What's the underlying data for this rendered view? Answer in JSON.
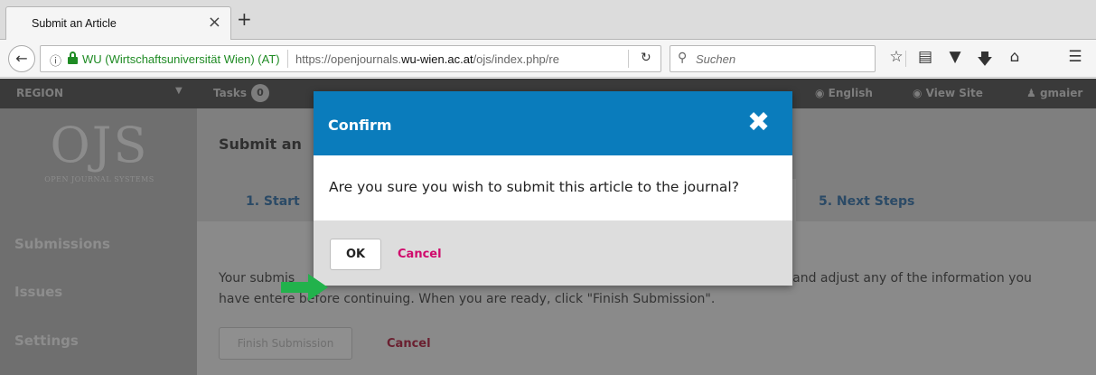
{
  "browser": {
    "tab_title": "Submit an Article",
    "tab_close": "×",
    "new_tab": "+",
    "back_icon": "arrow-left-icon",
    "info_icon": "ⓘ",
    "identity": "WU (Wirtschaftsuniversität Wien) (AT)",
    "url_prefix": "https://openjournals.",
    "url_domain": "wu-wien.ac.at",
    "url_suffix": "/ojs/index.php/re",
    "reload_icon": "↻",
    "search_placeholder": "Suchen",
    "toolbar_icons": [
      "star-icon",
      "reading-list-icon",
      "pocket-icon",
      "download-icon",
      "home-icon",
      "menu-icon"
    ]
  },
  "sidebar": {
    "region_label": "REGION",
    "logo_big": "OJS",
    "logo_small": "OPEN JOURNAL SYSTEMS",
    "items": [
      {
        "label": "Submissions"
      },
      {
        "label": "Issues"
      },
      {
        "label": "Settings"
      }
    ]
  },
  "topbar": {
    "tasks_label": "Tasks",
    "tasks_count": "0",
    "language": "English",
    "view_site": "View Site",
    "user": "gmaier"
  },
  "main": {
    "title": "Submit an",
    "steps": [
      {
        "label": "1. Start"
      },
      {
        "label": "5. Next Steps"
      }
    ],
    "body_start": "Your submis",
    "body_end": "w and adjust any of the information you",
    "body_line2_start": "have entere",
    "body_line2_end": "before continuing. When you are ready, click \"Finish Submission\".",
    "finish_button": "Finish Submission",
    "cancel_link": "Cancel"
  },
  "modal": {
    "title": "Confirm",
    "close_icon": "✖",
    "message": "Are you sure you wish to submit this article to the journal?",
    "ok_label": "OK",
    "cancel_label": "Cancel"
  },
  "colors": {
    "modal_header": "#0a7cbc",
    "cancel_link": "#d00a6c",
    "arrow": "#22b24c",
    "secure_green": "#1f8b24"
  }
}
